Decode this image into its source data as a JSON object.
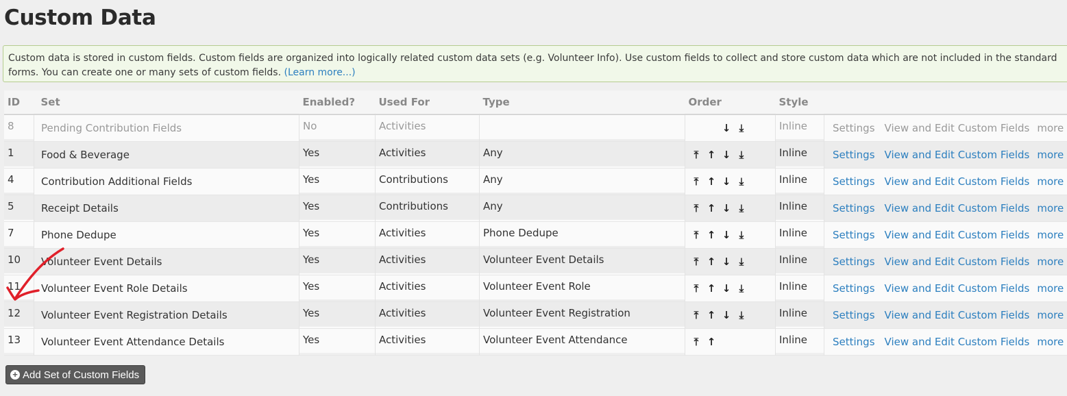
{
  "page_title": "Custom Data",
  "help": {
    "line1": "Custom data is stored in custom fields. Custom fields are organized into logically related custom data sets (e.g. Volunteer Info). Use custom fields to collect and store custom data which are not included in the standard",
    "line2": "forms. You can create one or many sets of custom fields. ",
    "learn_more": "(Learn more...)"
  },
  "table": {
    "headers": {
      "id": "ID",
      "set": "Set",
      "enabled": "Enabled?",
      "used_for": "Used For",
      "type": "Type",
      "order": "Order",
      "style": "Style"
    },
    "actions": {
      "settings": "Settings",
      "view_edit": "View and Edit Custom Fields",
      "more": "more"
    },
    "rows": [
      {
        "id": "8",
        "set": "Pending Contribution Fields",
        "enabled": "No",
        "used_for": "Activities",
        "type": "",
        "style": "Inline"
      },
      {
        "id": "1",
        "set": "Food & Beverage",
        "enabled": "Yes",
        "used_for": "Activities",
        "type": "Any",
        "style": "Inline"
      },
      {
        "id": "4",
        "set": "Contribution Additional Fields",
        "enabled": "Yes",
        "used_for": "Contributions",
        "type": "Any",
        "style": "Inline"
      },
      {
        "id": "5",
        "set": "Receipt Details",
        "enabled": "Yes",
        "used_for": "Contributions",
        "type": "Any",
        "style": "Inline"
      },
      {
        "id": "7",
        "set": "Phone Dedupe",
        "enabled": "Yes",
        "used_for": "Activities",
        "type": "Phone Dedupe",
        "style": "Inline"
      },
      {
        "id": "10",
        "set": "Volunteer Event Details",
        "enabled": "Yes",
        "used_for": "Activities",
        "type": "Volunteer Event Details",
        "style": "Inline"
      },
      {
        "id": "11",
        "set": "Volunteer Event Role Details",
        "enabled": "Yes",
        "used_for": "Activities",
        "type": "Volunteer Event Role",
        "style": "Inline"
      },
      {
        "id": "12",
        "set": "Volunteer Event Registration Details",
        "enabled": "Yes",
        "used_for": "Activities",
        "type": "Volunteer Event Registration",
        "style": "Inline"
      },
      {
        "id": "13",
        "set": "Volunteer Event Attendance Details",
        "enabled": "Yes",
        "used_for": "Activities",
        "type": "Volunteer Event Attendance",
        "style": "Inline"
      }
    ]
  },
  "add_button": "Add Set of Custom Fields",
  "icons": {
    "order_top": "⤒",
    "order_up": "↑",
    "order_down": "↓",
    "order_bottom": "⤓",
    "more_caret": "▸",
    "plus": "+"
  },
  "colors": {
    "link": "#2c7fbf",
    "annotation": "#e0202a"
  }
}
